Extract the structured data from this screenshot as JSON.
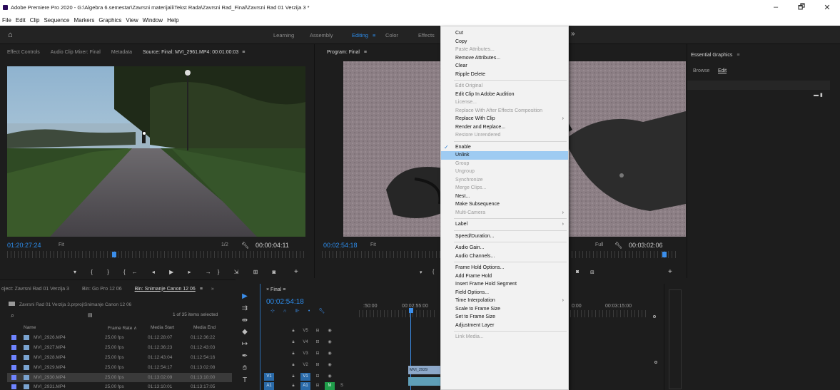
{
  "window": {
    "title": "Adobe Premiere Pro 2020 - G:\\Algebra 6.semestar\\Zavrsni materijali\\Tekst Rada\\Zavrsni Rad_Final\\Zavrsni Rad 01 Verzija 3 *",
    "controls": {
      "minimize": "–",
      "restore": "🗗",
      "close": "✕"
    }
  },
  "menubar": [
    "File",
    "Edit",
    "Clip",
    "Sequence",
    "Markers",
    "Graphics",
    "View",
    "Window",
    "Help"
  ],
  "workspaces": {
    "home_icon": "home-icon",
    "items": [
      "Learning",
      "Assembly",
      "Editing",
      "≡",
      "Color",
      "Effects"
    ],
    "active": "Editing",
    "more": "»"
  },
  "source_panel": {
    "tabs": [
      "Effect Controls",
      "Audio Clip Mixer: Final",
      "Metadata",
      "Source: Final: MVI_2961.MP4: 00:01:00:03",
      "≡"
    ],
    "timecode": "01:20:27:24",
    "fit": "Fit",
    "ratio": "1/2",
    "duration": "00:00:04:11",
    "transport": "▾ { } {← ◂ ▶ ▸ →} ⇲ ⊞ ◙",
    "add": "+"
  },
  "program_panel": {
    "tab": "Program: Final",
    "timecode": "00:02:54:18",
    "fit": "Fit",
    "quality": "Full",
    "duration": "00:03:02:06",
    "add": "+"
  },
  "essential_graphics": {
    "title": "Essential Graphics",
    "menu": "≡",
    "tabs": [
      "Browse",
      "Edit"
    ],
    "active_tab": "Edit"
  },
  "project_panel": {
    "tabs": [
      "oject: Zavrsni Rad 01 Verzija 3",
      "Bin: Go Pro 12 06",
      "Bin: Snimanje Canon 12 06",
      "≡",
      "»"
    ],
    "path": "Zavrsni Rad 01 Verzija 3.prproj\\Snimanje Canon 12 06",
    "search_icon": "search-icon",
    "count": "1 of 35 items selected",
    "columns": [
      "Name",
      "Frame Rate ∧",
      "Media Start",
      "Media End"
    ],
    "rows": [
      {
        "name": "MVI_2926.MP4",
        "fps": "25,00 fps",
        "start": "01:12:28:07",
        "end": "01:12:36:22"
      },
      {
        "name": "MVI_2927.MP4",
        "fps": "25,00 fps",
        "start": "01:12:36:23",
        "end": "01:12:43:03"
      },
      {
        "name": "MVI_2928.MP4",
        "fps": "25,00 fps",
        "start": "01:12:43:04",
        "end": "01:12:54:16"
      },
      {
        "name": "MVI_2929.MP4",
        "fps": "25,00 fps",
        "start": "01:12:54:17",
        "end": "01:13:02:08"
      },
      {
        "name": "MVI_2930.MP4",
        "fps": "25,00 fps",
        "start": "01:13:02:09",
        "end": "01:13:10:00"
      },
      {
        "name": "MVI_2931.MP4",
        "fps": "25,00 fps",
        "start": "01:13:10:01",
        "end": "01:13:17:05"
      }
    ],
    "selected_row": 4
  },
  "timeline": {
    "tab": "Final",
    "menu": "≡",
    "timecode": "00:02:54:18",
    "ruler": [
      ":50:00",
      "00:02:55:00",
      "0:00",
      "00:03:15:00"
    ],
    "tracks": [
      "V5",
      "V4",
      "V3",
      "V2",
      "V1",
      "A1"
    ],
    "clip_label": "MVI_2929"
  },
  "context_menu": {
    "items": [
      {
        "label": "Cut",
        "disabled": false
      },
      {
        "label": "Copy",
        "disabled": false
      },
      {
        "label": "Paste Attributes...",
        "disabled": true
      },
      {
        "label": "Remove Attributes...",
        "disabled": false
      },
      {
        "label": "Clear",
        "disabled": false
      },
      {
        "label": "Ripple Delete",
        "disabled": false
      },
      {
        "sep": true
      },
      {
        "label": "Edit Original",
        "disabled": true
      },
      {
        "label": "Edit Clip In Adobe Audition",
        "disabled": false
      },
      {
        "label": "License...",
        "disabled": true
      },
      {
        "label": "Replace With After Effects Composition",
        "disabled": true
      },
      {
        "label": "Replace With Clip",
        "disabled": false,
        "submenu": true
      },
      {
        "label": "Render and Replace...",
        "disabled": false
      },
      {
        "label": "Restore Unrendered",
        "disabled": true
      },
      {
        "sep": true
      },
      {
        "label": "Enable",
        "disabled": false,
        "checked": true
      },
      {
        "label": "Unlink",
        "disabled": false,
        "highlighted": true
      },
      {
        "label": "Group",
        "disabled": true
      },
      {
        "label": "Ungroup",
        "disabled": true
      },
      {
        "label": "Synchronize",
        "disabled": true
      },
      {
        "label": "Merge Clips...",
        "disabled": true
      },
      {
        "label": "Nest...",
        "disabled": false
      },
      {
        "label": "Make Subsequence",
        "disabled": false
      },
      {
        "label": "Multi-Camera",
        "disabled": true,
        "submenu": true
      },
      {
        "sep": true
      },
      {
        "label": "Label",
        "disabled": false,
        "submenu": true
      },
      {
        "sep": true
      },
      {
        "label": "Speed/Duration...",
        "disabled": false
      },
      {
        "sep": true
      },
      {
        "label": "Audio Gain...",
        "disabled": false
      },
      {
        "label": "Audio Channels...",
        "disabled": false
      },
      {
        "sep": true
      },
      {
        "label": "Frame Hold Options...",
        "disabled": false
      },
      {
        "label": "Add Frame Hold",
        "disabled": false
      },
      {
        "label": "Insert Frame Hold Segment",
        "disabled": false
      },
      {
        "label": "Field Options...",
        "disabled": false
      },
      {
        "label": "Time Interpolation",
        "disabled": false,
        "submenu": true
      },
      {
        "label": "Scale to Frame Size",
        "disabled": false
      },
      {
        "label": "Set to Frame Size",
        "disabled": false
      },
      {
        "label": "Adjustment Layer",
        "disabled": false
      },
      {
        "sep": true
      },
      {
        "label": "Link Media...",
        "disabled": true
      }
    ]
  },
  "colors": {
    "accent_blue": "#2d8ceb",
    "menu_highlight": "#9ecbf2",
    "label_violet": "#6f84ff"
  }
}
